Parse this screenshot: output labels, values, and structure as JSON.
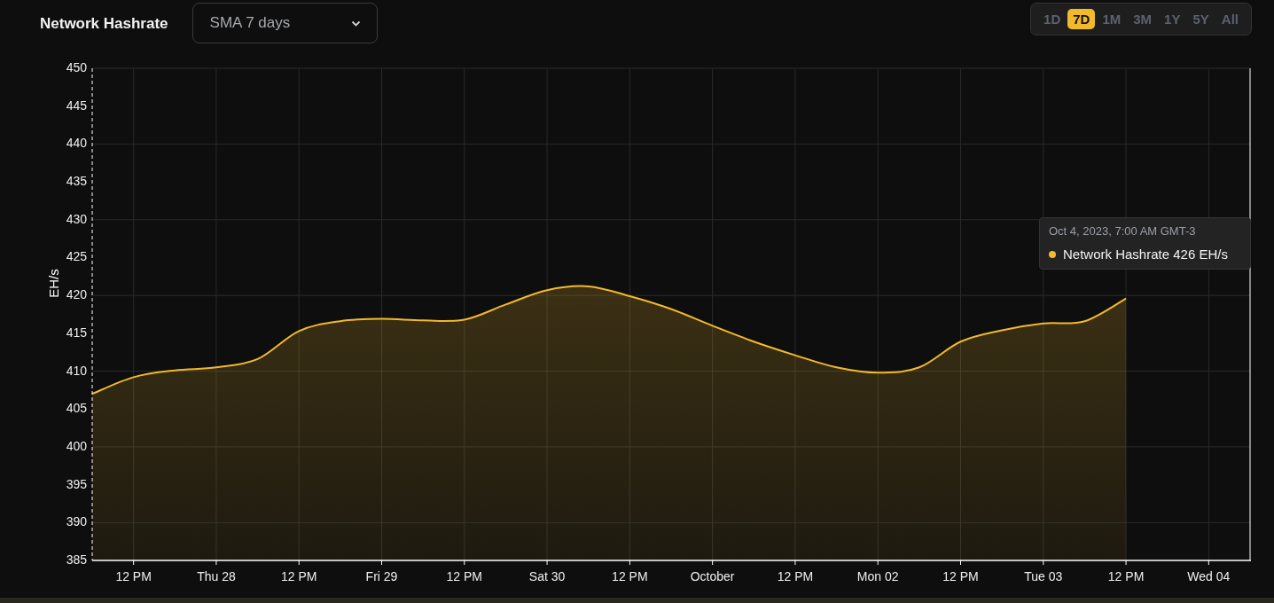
{
  "header": {
    "title": "Network Hashrate",
    "average_select": {
      "value": "SMA 7 days"
    },
    "ranges": [
      {
        "label": "1D",
        "selected": false
      },
      {
        "label": "7D",
        "selected": true
      },
      {
        "label": "1M",
        "selected": false
      },
      {
        "label": "3M",
        "selected": false
      },
      {
        "label": "1Y",
        "selected": false
      },
      {
        "label": "5Y",
        "selected": false
      },
      {
        "label": "All",
        "selected": false
      }
    ]
  },
  "chart": {
    "chart_data": {
      "type": "area",
      "ylabel": "EH/s",
      "categories": [
        null,
        "12 PM",
        null,
        "Thu 28",
        null,
        "12 PM",
        null,
        "Fri 29",
        null,
        "12 PM",
        null,
        "Sat 30",
        null,
        "12 PM",
        null,
        "October",
        null,
        "12 PM",
        null,
        "Mon 02",
        null,
        "12 PM",
        null,
        "Tue 03",
        null,
        "12 PM",
        null,
        "Wed 04",
        null
      ],
      "series": [
        {
          "name": "Network Hashrate",
          "color": "#f2b92c",
          "values": [
            407.0,
            409.2,
            410.1,
            410.5,
            411.6,
            415.3,
            416.6,
            416.9,
            416.7,
            416.8,
            418.8,
            420.7,
            421.2,
            419.9,
            418.2,
            416.0,
            413.9,
            412.1,
            410.5,
            409.8,
            410.5,
            413.9,
            415.4,
            416.3,
            416.6,
            419.6,
            null,
            null,
            null
          ]
        }
      ],
      "ylim": [
        385,
        450
      ],
      "grid": true,
      "yticks": [
        385,
        390,
        395,
        400,
        405,
        410,
        415,
        420,
        425,
        430,
        435,
        440,
        445,
        450
      ]
    },
    "tooltip": {
      "time": "Oct 4, 2023, 7:00 AM GMT-3",
      "value": "426 EH/s"
    }
  }
}
